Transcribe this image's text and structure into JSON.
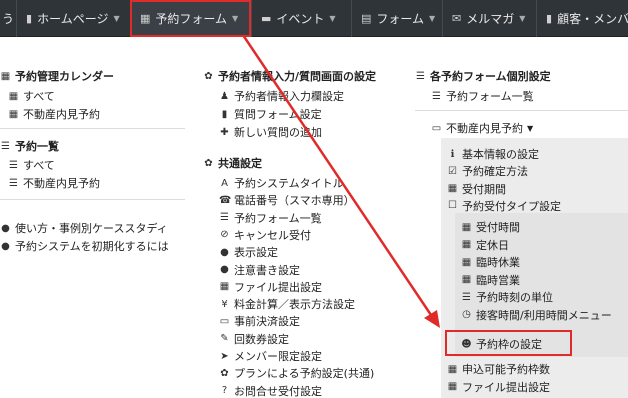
{
  "nav": {
    "items": [
      {
        "icon": "file-icon",
        "glyph": "▮",
        "label": "ホームページ"
      },
      {
        "icon": "calendar-icon",
        "glyph": "▦",
        "label": "予約フォーム"
      },
      {
        "icon": "comment-icon",
        "glyph": "▬",
        "label": "イベント"
      },
      {
        "icon": "form-icon",
        "glyph": "▤",
        "label": "フォーム"
      },
      {
        "icon": "envelope-icon",
        "glyph": "✉",
        "label": "メルマガ"
      },
      {
        "icon": "book-icon",
        "glyph": "▮",
        "label": "顧客・メンバ"
      }
    ],
    "leading_fragment": "う"
  },
  "col1": {
    "h1": "予約管理カレンダー",
    "h1_items": [
      "すべて",
      "不動産内見予約"
    ],
    "h2": "予約一覧",
    "h2_items": [
      "すべて",
      "不動産内見予約"
    ],
    "links": [
      "使い方・事例別ケーススタディ",
      "予約システムを初期化するには"
    ]
  },
  "col2": {
    "h1": "予約者情報入力/質問画面の設定",
    "h1_items": [
      "予約者情報入力欄設定",
      "質問フォーム設定",
      "新しい質問の追加"
    ],
    "h2": "共通設定",
    "h2_items": [
      {
        "icon": "font-icon",
        "glyph": "A",
        "label": "予約システムタイトル"
      },
      {
        "icon": "phone-icon",
        "glyph": "☎",
        "label": "電話番号（スマホ専用）"
      },
      {
        "icon": "list-icon",
        "glyph": "☰",
        "label": "予約フォーム一覧"
      },
      {
        "icon": "ban-icon",
        "glyph": "⊘",
        "label": "キャンセル受付"
      },
      {
        "icon": "comment-icon",
        "glyph": "●",
        "label": "表示設定"
      },
      {
        "icon": "comment-icon",
        "glyph": "●",
        "label": "注意書き設定"
      },
      {
        "icon": "calendar-icon",
        "glyph": "▦",
        "label": "ファイル提出設定"
      },
      {
        "icon": "yen-icon",
        "glyph": "¥",
        "label": "料金計算／表示方法設定"
      },
      {
        "icon": "credit-card-icon",
        "glyph": "▭",
        "label": "事前決済設定"
      },
      {
        "icon": "ticket-icon",
        "glyph": "✎",
        "label": "回数券設定"
      },
      {
        "icon": "user-icon",
        "glyph": "➤",
        "label": "メンバー限定設定"
      },
      {
        "icon": "gear-icon",
        "glyph": "✿",
        "label": "プランによる予約設定(共通)"
      },
      {
        "icon": "question-icon",
        "glyph": "?",
        "label": "お問合せ受付設定"
      }
    ]
  },
  "col3": {
    "h1": "各予約フォーム個別設定",
    "list_link": "予約フォーム一覧",
    "form_name": "不動産内見予約",
    "form_items": [
      {
        "icon": "info-icon",
        "glyph": "ℹ",
        "label": "基本情報の設定"
      },
      {
        "icon": "check-square-icon",
        "glyph": "☑",
        "label": "予約確定方法"
      },
      {
        "icon": "calendar-check-icon",
        "glyph": "▦",
        "label": "受付期間"
      },
      {
        "icon": "square-icon",
        "glyph": "☐",
        "label": "予約受付タイプ設定"
      }
    ],
    "type_items": [
      {
        "icon": "calendar-icon",
        "glyph": "▦",
        "label": "受付時間"
      },
      {
        "icon": "calendar-icon",
        "glyph": "▦",
        "label": "定休日"
      },
      {
        "icon": "calendar-icon",
        "glyph": "▦",
        "label": "臨時休業"
      },
      {
        "icon": "calendar-icon",
        "glyph": "▦",
        "label": "臨時営業"
      },
      {
        "icon": "bars-icon",
        "glyph": "☰",
        "label": "予約時刻の単位"
      },
      {
        "icon": "clock-icon",
        "glyph": "◷",
        "label": "接客時間/利用時間メニュー"
      },
      {
        "icon": "users-icon",
        "glyph": "☻",
        "label": "予約枠の設定"
      }
    ],
    "after_items": [
      {
        "icon": "calendar-icon",
        "glyph": "▦",
        "label": "申込可能予約枠数"
      },
      {
        "icon": "calendar-icon",
        "glyph": "▦",
        "label": "ファイル提出設定"
      }
    ]
  },
  "colors": {
    "accent": "#e02b2b",
    "nav_bg": "#2f3439"
  }
}
